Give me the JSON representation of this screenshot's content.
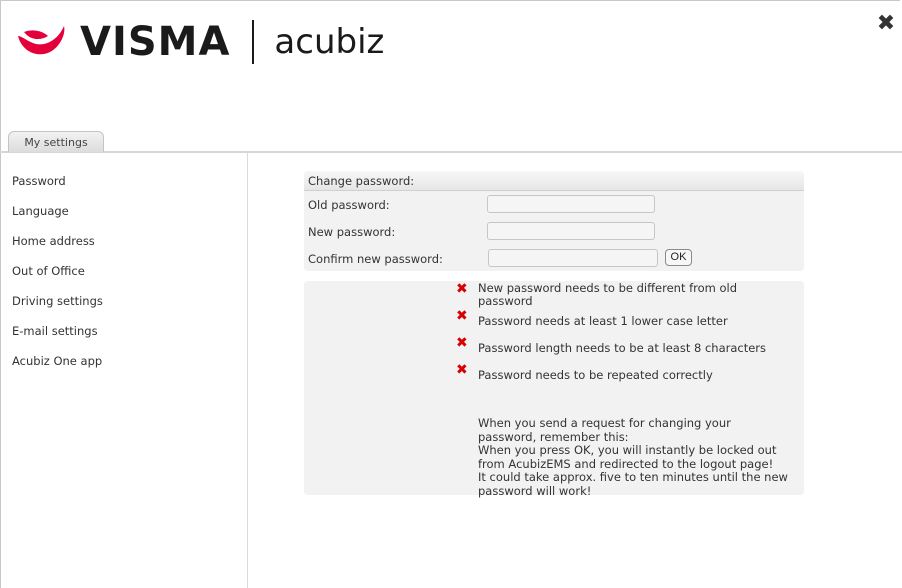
{
  "brand": {
    "logo_text": "VISMA",
    "product": "acubiz",
    "color": "#e4003b"
  },
  "close_icon": "close-icon",
  "tabs": [
    {
      "label": "My settings"
    }
  ],
  "sidebar": {
    "items": [
      {
        "label": "Password"
      },
      {
        "label": "Language"
      },
      {
        "label": "Home address"
      },
      {
        "label": "Out of Office"
      },
      {
        "label": "Driving settings"
      },
      {
        "label": "E-mail settings"
      },
      {
        "label": "Acubiz One app"
      }
    ]
  },
  "change_password": {
    "title": "Change password:",
    "old_label": "Old password:",
    "new_label": "New password:",
    "confirm_label": "Confirm new password:",
    "old_value": "",
    "new_value": "",
    "confirm_value": "",
    "ok_label": "OK"
  },
  "rules": [
    {
      "icon": "error-x-icon",
      "text": "New password needs to be different from old password"
    },
    {
      "icon": "error-x-icon",
      "text": "Password needs at least 1 lower case letter"
    },
    {
      "icon": "error-x-icon",
      "text": "Password length needs to be at least 8 characters"
    },
    {
      "icon": "error-x-icon",
      "text": "Password needs to be repeated correctly"
    }
  ],
  "note": "When you send a request for changing your password, remember this:\nWhen you press OK, you will instantly be locked out from AcubizEMS and redirected to the logout page!\nIt could take approx. five to ten minutes until the new password will work!",
  "colors": {
    "error": "#d80000",
    "panel_bg": "#f2f2f2"
  }
}
